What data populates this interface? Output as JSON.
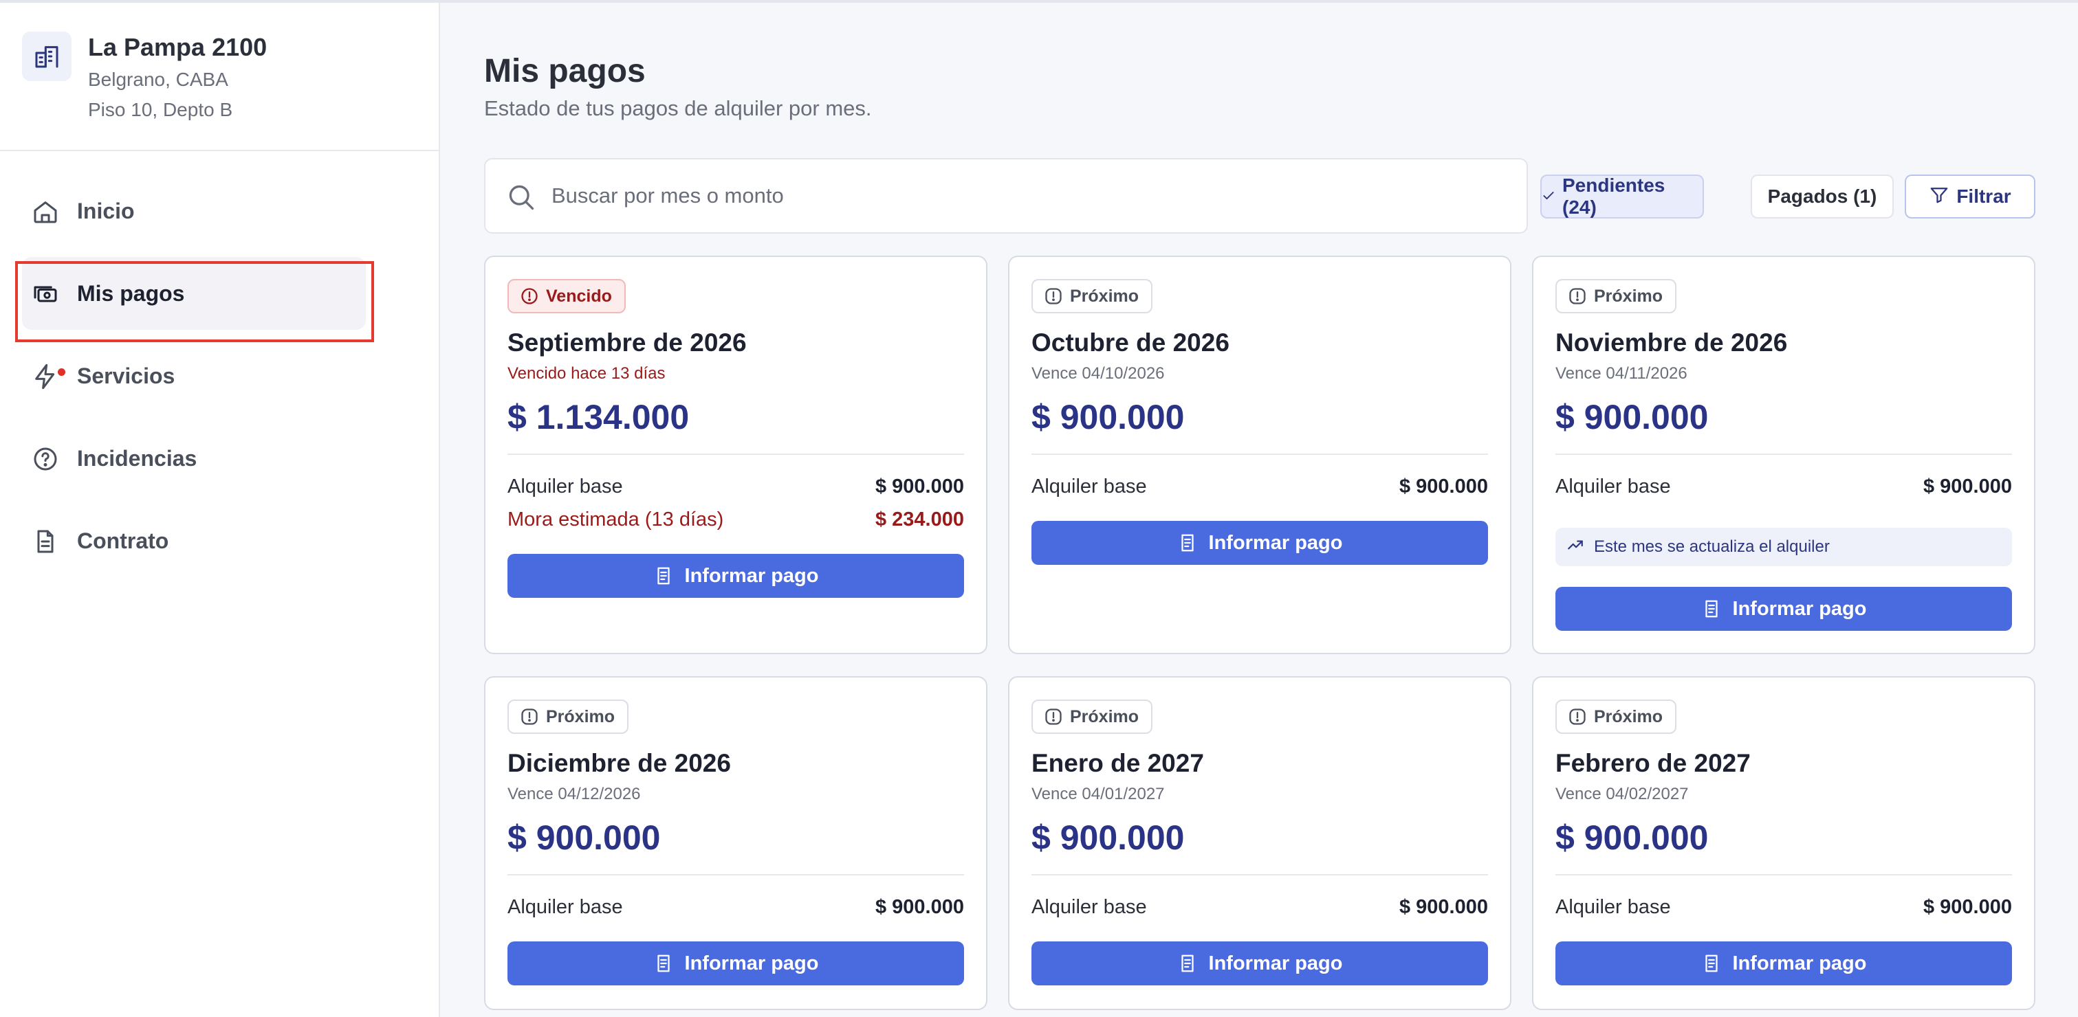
{
  "property": {
    "name": "La Pampa 2100",
    "line1": "Belgrano, CABA",
    "line2": "Piso 10, Depto B",
    "icon": "building-icon"
  },
  "nav": [
    {
      "label": "Inicio",
      "icon": "home-icon",
      "active": false
    },
    {
      "label": "Mis pagos",
      "icon": "money-icon",
      "active": true
    },
    {
      "label": "Servicios",
      "icon": "lightning-icon",
      "active": false,
      "notification_dot": true
    },
    {
      "label": "Incidencias",
      "icon": "help-circle-icon",
      "active": false
    },
    {
      "label": "Contrato",
      "icon": "document-icon",
      "active": false
    }
  ],
  "header": {
    "title": "Mis pagos",
    "subtitle": "Estado de tus pagos de alquiler por mes."
  },
  "search": {
    "placeholder": "Buscar por mes o monto",
    "value": ""
  },
  "filters": {
    "pending_label": "Pendientes (24)",
    "paid_label": "Pagados (1)",
    "filter_label": "Filtrar",
    "selected": "pending"
  },
  "cards": [
    {
      "badge": "Vencido",
      "badge_type": "overdue",
      "month": "Septiembre de 2026",
      "due": "Vencido hace 13 días",
      "amount": "$ 1.134.000",
      "rows": [
        {
          "label": "Alquiler base",
          "value": "$ 900.000"
        },
        {
          "label": "Mora estimada (13 días)",
          "value": "$ 234.000"
        }
      ],
      "button": "Informar pago"
    },
    {
      "badge": "Próximo",
      "badge_type": "next",
      "month": "Octubre de 2026",
      "due": "Vence 04/10/2026",
      "amount": "$ 900.000",
      "rows": [
        {
          "label": "Alquiler base",
          "value": "$ 900.000"
        }
      ],
      "button": "Informar pago"
    },
    {
      "badge": "Próximo",
      "badge_type": "next",
      "month": "Noviembre de 2026",
      "due": "Vence 04/11/2026",
      "amount": "$ 900.000",
      "rows": [
        {
          "label": "Alquiler base",
          "value": "$ 900.000"
        }
      ],
      "notice": "Este mes se actualiza el alquiler",
      "button": "Informar pago"
    },
    {
      "badge": "Próximo",
      "badge_type": "next",
      "month": "Diciembre de 2026",
      "due": "Vence 04/12/2026",
      "amount": "$ 900.000",
      "rows": [
        {
          "label": "Alquiler base",
          "value": "$ 900.000"
        }
      ],
      "button": "Informar pago"
    },
    {
      "badge": "Próximo",
      "badge_type": "next",
      "month": "Enero de 2027",
      "due": "Vence 04/01/2027",
      "amount": "$ 900.000",
      "rows": [
        {
          "label": "Alquiler base",
          "value": "$ 900.000"
        }
      ],
      "button": "Informar pago"
    },
    {
      "badge": "Próximo",
      "badge_type": "next",
      "month": "Febrero de 2027",
      "due": "Vence 04/02/2027",
      "amount": "$ 900.000",
      "rows": [
        {
          "label": "Alquiler base",
          "value": "$ 900.000"
        }
      ],
      "button": "Informar pago"
    }
  ],
  "colors": {
    "accent": "#4a6be0",
    "amount": "#2a3386",
    "overdue": "#9a1a1a",
    "highlight": "#e53a2f"
  }
}
